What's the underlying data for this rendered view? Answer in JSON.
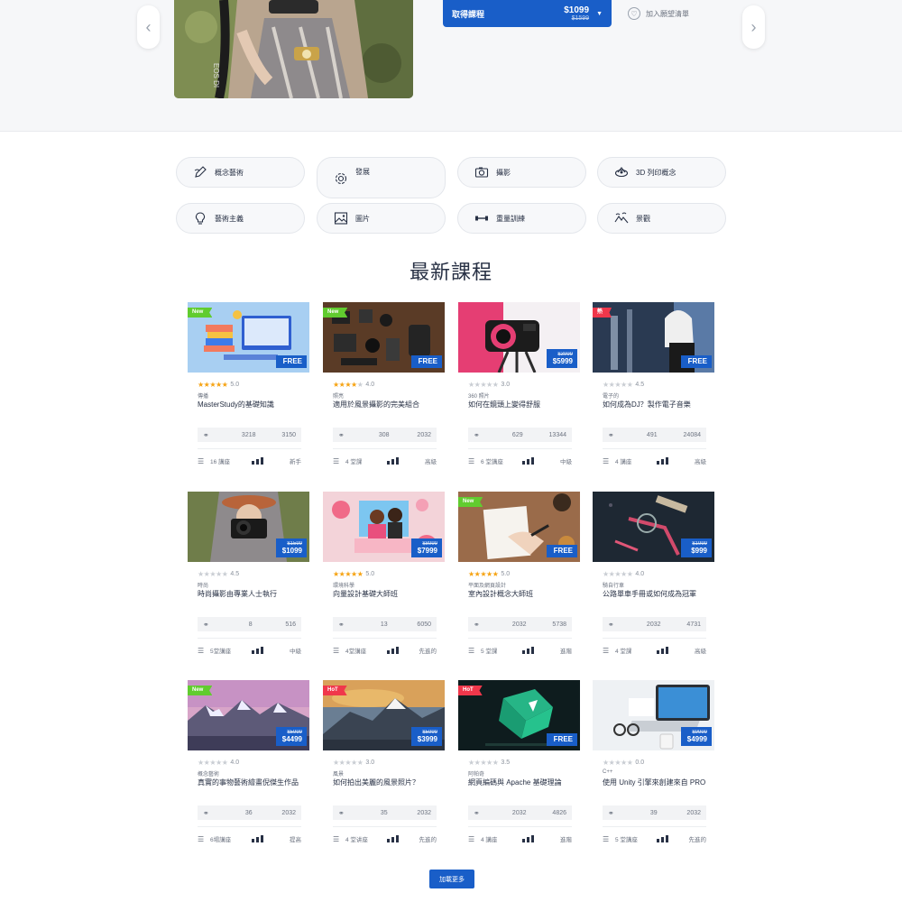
{
  "hero": {
    "buy_label": "取得課程",
    "buy_price": "$1099",
    "buy_old_price": "$1599",
    "wishlist_label": "加入願望清單",
    "camera_text": "EOS DI"
  },
  "categories": [
    {
      "label": "概念藝術",
      "icon": "pencil-icon"
    },
    {
      "label": "發展",
      "icon": "gear-icon"
    },
    {
      "label": "攝影",
      "icon": "camera-icon"
    },
    {
      "label": "3D 列印概念",
      "icon": "3d-printer-icon"
    },
    {
      "label": "藝術主義",
      "icon": "lightbulb-icon"
    },
    {
      "label": "圖片",
      "icon": "image-icon"
    },
    {
      "label": "重量訓練",
      "icon": "dumbbell-icon"
    },
    {
      "label": "景觀",
      "icon": "landscape-icon"
    }
  ],
  "section_title": "最新課程",
  "courses": [
    {
      "badge": "New",
      "badge_type": "new",
      "price": "FREE",
      "old_price": "",
      "rating": 5,
      "rating_text": "5.0",
      "category": "傳播",
      "title": "MasterStudy的基礎知識",
      "students": "3218",
      "views": "3150",
      "lectures": "16 講座",
      "level": "新手",
      "level_bars": 2
    },
    {
      "badge": "New",
      "badge_type": "new",
      "price": "FREE",
      "old_price": "",
      "rating": 4,
      "rating_text": "4.0",
      "category": "照亮",
      "title": "適用於風景攝影的完美組合",
      "students": "308",
      "views": "2032",
      "lectures": "4 堂課",
      "level": "高級",
      "level_bars": 2
    },
    {
      "badge": "",
      "badge_type": "",
      "price": "$5999",
      "old_price": "$3999",
      "rating": 0,
      "rating_text": "3.0",
      "category": "360 照片",
      "title": "如何在鏡頭上變得舒服",
      "students": "629",
      "views": "13344",
      "lectures": "6 堂講座",
      "level": "中級",
      "level_bars": 3
    },
    {
      "badge": "熱",
      "badge_type": "hot",
      "price": "FREE",
      "old_price": "",
      "rating": 0,
      "rating_text": "4.5",
      "category": "電子的",
      "title": "如何成為DJ？製作電子音樂",
      "students": "491",
      "views": "24084",
      "lectures": "4 講座",
      "level": "高級",
      "level_bars": 2
    },
    {
      "badge": "",
      "badge_type": "",
      "price": "$1099",
      "old_price": "$1599",
      "rating": 0,
      "rating_text": "4.5",
      "category": "時尚",
      "title": "時尚攝影由專業人士執行",
      "students": "8",
      "views": "516",
      "lectures": "5堂講座",
      "level": "中級",
      "level_bars": 3
    },
    {
      "badge": "",
      "badge_type": "",
      "price": "$7999",
      "old_price": "$8999",
      "rating": 5,
      "rating_text": "5.0",
      "category": "環境科學",
      "title": "向量設計基礎大師班",
      "students": "13",
      "views": "6050",
      "lectures": "4堂講座",
      "level": "先進的",
      "level_bars": 2
    },
    {
      "badge": "New",
      "badge_type": "new",
      "price": "FREE",
      "old_price": "",
      "rating": 5,
      "rating_text": "5.0",
      "category": "平面及網頁設計",
      "title": "室內設計概念大師班",
      "students": "2032",
      "views": "5738",
      "lectures": "5 堂課",
      "level": "進階",
      "level_bars": 2
    },
    {
      "badge": "",
      "badge_type": "",
      "price": "$999",
      "old_price": "$1999",
      "rating": 0,
      "rating_text": "4.0",
      "category": "騎自行車",
      "title": "公路單車手冊或如何成為冠軍",
      "students": "2032",
      "views": "4731",
      "lectures": "4 堂課",
      "level": "高級",
      "level_bars": 2
    },
    {
      "badge": "New",
      "badge_type": "new",
      "price": "$4499",
      "old_price": "$5999",
      "rating": 0,
      "rating_text": "4.0",
      "category": "概念藝術",
      "title": "真實的事物藝術繪畫倪傑生作品",
      "students": "36",
      "views": "2032",
      "lectures": "6場講座",
      "level": "提高",
      "level_bars": 2
    },
    {
      "badge": "HoT",
      "badge_type": "hot",
      "price": "$3999",
      "old_price": "$5999",
      "rating": 0,
      "rating_text": "3.0",
      "category": "風景",
      "title": "如何拍出美麗的風景照片？",
      "students": "35",
      "views": "2032",
      "lectures": "4 堂讲座",
      "level": "先進的",
      "level_bars": 2
    },
    {
      "badge": "HoT",
      "badge_type": "hot",
      "price": "FREE",
      "old_price": "",
      "rating": 0,
      "rating_text": "3.5",
      "category": "阿帕奇",
      "title": "網頁編碼與 Apache 基礎理論",
      "students": "2032",
      "views": "4826",
      "lectures": "4 講座",
      "level": "進階",
      "level_bars": 2
    },
    {
      "badge": "",
      "badge_type": "",
      "price": "$4999",
      "old_price": "$9999",
      "rating": 0,
      "rating_text": "0.0",
      "category": "C++",
      "title": "使用 Unity 引擎來創建來自 PRO",
      "students": "39",
      "views": "2032",
      "lectures": "5 堂講座",
      "level": "先進的",
      "level_bars": 2
    }
  ],
  "load_more_label": "加載更多",
  "colors": {
    "accent": "#195ec8",
    "new_badge": "#61cc2f",
    "hot_badge": "#f0374b",
    "star": "#f6a312",
    "text": "#273044"
  }
}
